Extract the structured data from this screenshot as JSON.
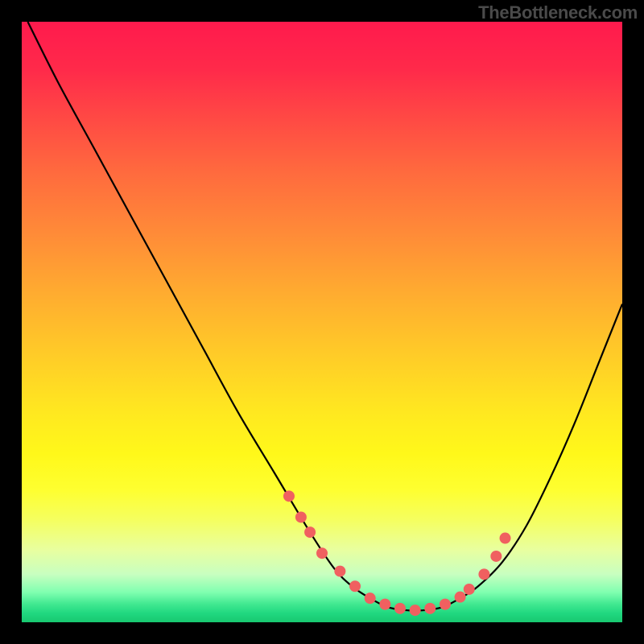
{
  "watermark": "TheBottleneck.com",
  "chart_data": {
    "type": "line",
    "title": "",
    "xlabel": "",
    "ylabel": "",
    "xlim": [
      0,
      100
    ],
    "ylim": [
      0,
      100
    ],
    "curve": {
      "name": "bottleneck-curve",
      "x": [
        1,
        6,
        12,
        18,
        24,
        30,
        36,
        42,
        48,
        52,
        55,
        58,
        61,
        64,
        67,
        70,
        73,
        76,
        80,
        84,
        88,
        92,
        96,
        100
      ],
      "y": [
        100,
        90,
        79,
        68,
        57,
        46,
        35,
        25,
        15,
        9,
        6,
        4,
        2.5,
        2,
        2,
        2.5,
        4,
        6,
        10,
        16,
        24,
        33,
        43,
        53
      ]
    },
    "markers": {
      "name": "highlighted-points",
      "color": "#f06060",
      "radius_px": 7,
      "x": [
        44.5,
        46.5,
        48,
        50,
        53,
        55.5,
        58,
        60.5,
        63,
        65.5,
        68,
        70.5,
        73,
        74.5,
        77,
        79,
        80.5
      ],
      "y": [
        21,
        17.5,
        15,
        11.5,
        8.5,
        6,
        4,
        3,
        2.3,
        2,
        2.3,
        3,
        4.2,
        5.5,
        8,
        11,
        14
      ]
    },
    "gradient_stops": [
      {
        "pos": 0,
        "color": "#ff1a4d"
      },
      {
        "pos": 0.5,
        "color": "#ffca28"
      },
      {
        "pos": 0.8,
        "color": "#fff81a"
      },
      {
        "pos": 1.0,
        "color": "#18c870"
      }
    ]
  }
}
